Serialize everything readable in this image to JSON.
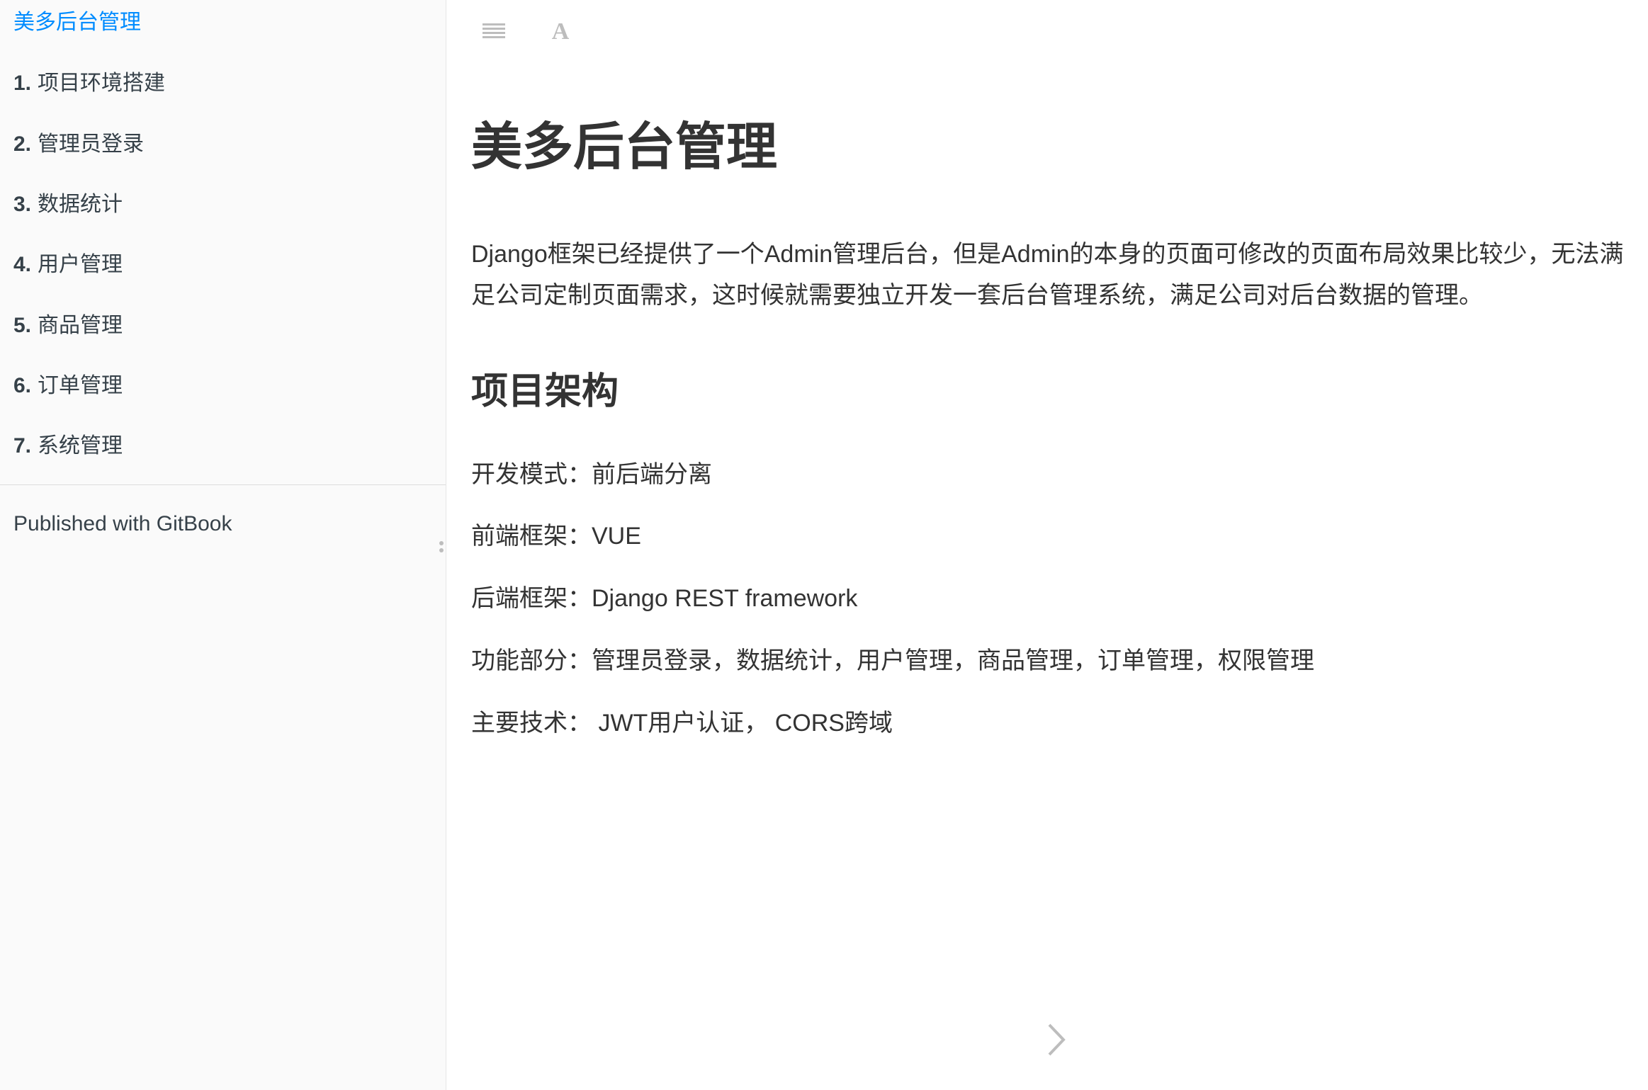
{
  "sidebar": {
    "title": "美多后台管理",
    "items": [
      {
        "num": "1.",
        "label": "项目环境搭建"
      },
      {
        "num": "2.",
        "label": "管理员登录"
      },
      {
        "num": "3.",
        "label": "数据统计"
      },
      {
        "num": "4.",
        "label": "用户管理"
      },
      {
        "num": "5.",
        "label": "商品管理"
      },
      {
        "num": "6.",
        "label": "订单管理"
      },
      {
        "num": "7.",
        "label": "系统管理"
      }
    ],
    "published": "Published with GitBook"
  },
  "toolbar": {
    "menu_icon": "hamburger-menu-icon",
    "font_icon": "font-settings-icon",
    "font_glyph": "A"
  },
  "page": {
    "title": "美多后台管理",
    "intro": "Django框架已经提供了一个Admin管理后台，但是Admin的本身的页面可修改的页面布局效果比较少，无法满足公司定制页面需求，这时候就需要独立开发一套后台管理系统，满足公司对后台数据的管理。",
    "section_title": "项目架构",
    "specs": [
      "开发模式：前后端分离",
      "前端框架：VUE",
      "后端框架：Django REST framework",
      "功能部分：管理员登录，数据统计，用户管理，商品管理，订单管理，权限管理",
      "主要技术： JWT用户认证， CORS跨域"
    ]
  },
  "navigation": {
    "next_icon": "chevron-right-icon"
  },
  "colors": {
    "accent": "#008cff",
    "sidebar_bg": "#fafafa",
    "text": "#333333",
    "icon_gray": "#bdbdbd"
  }
}
